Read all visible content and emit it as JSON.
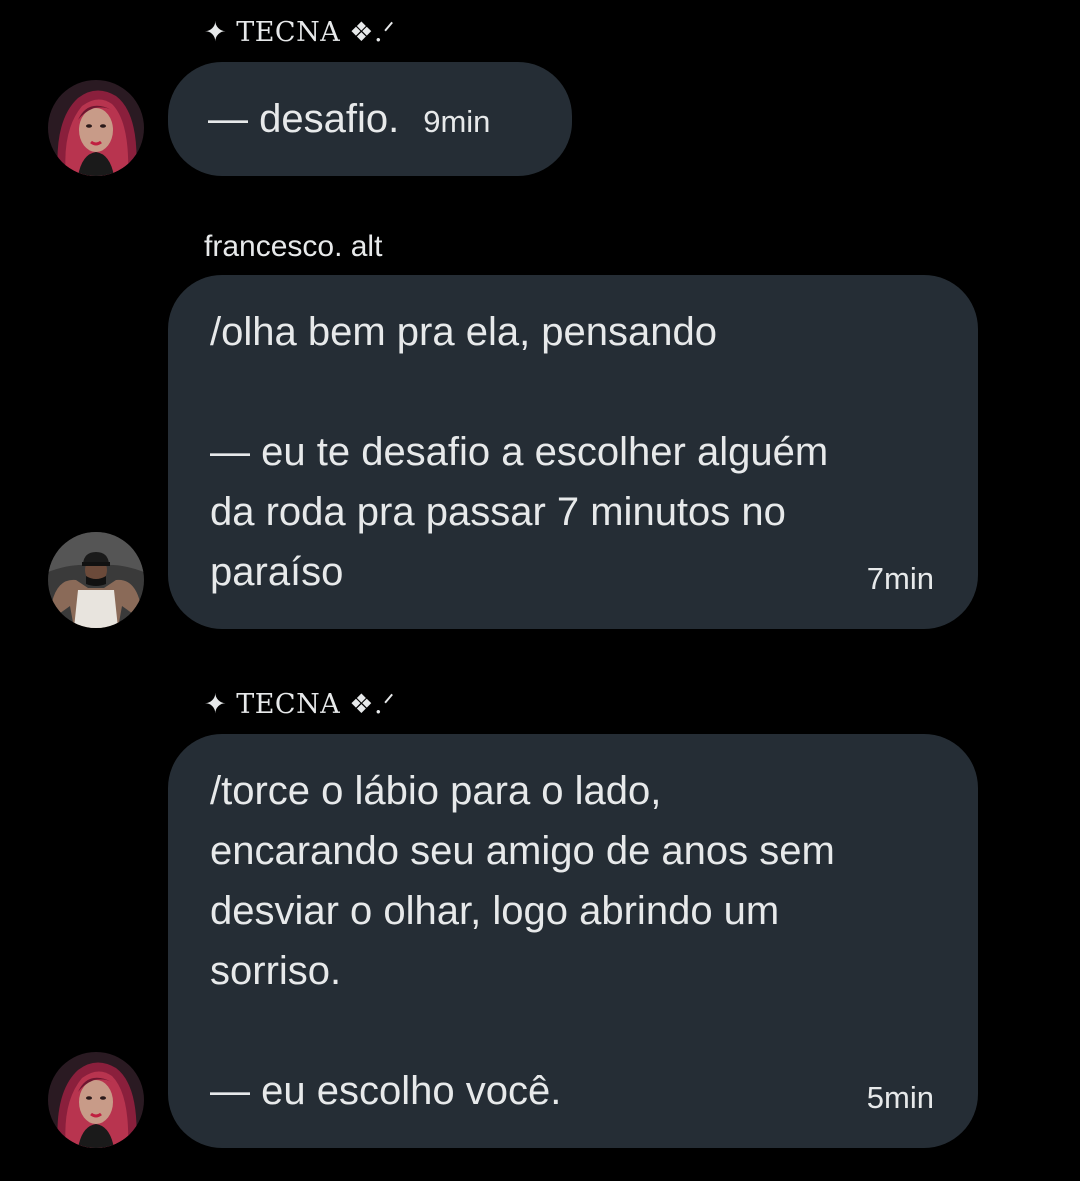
{
  "messages": [
    {
      "sender": "✦ TECNA ❖.ᐟ",
      "text": "— desafio.",
      "time": "9min",
      "avatar_icon": "woman-pink-hair-avatar"
    },
    {
      "sender": "francesco. alt",
      "text": "/olha bem pra ela, pensando\n\n— eu te desafio a escolher alguém\nda roda pra passar 7 minutos no\nparaíso",
      "time": "7min",
      "avatar_icon": "man-cap-avatar"
    },
    {
      "sender": "✦ TECNA ❖.ᐟ",
      "text": "/torce o lábio para o lado,\nencarando seu amigo de anos sem\ndesviar o olhar, logo abrindo um\nsorriso.\n\n— eu escolho você.",
      "time": "5min",
      "avatar_icon": "woman-pink-hair-avatar"
    }
  ],
  "colors": {
    "background": "#000000",
    "bubble": "#252d35",
    "text": "#e7e9ea"
  }
}
